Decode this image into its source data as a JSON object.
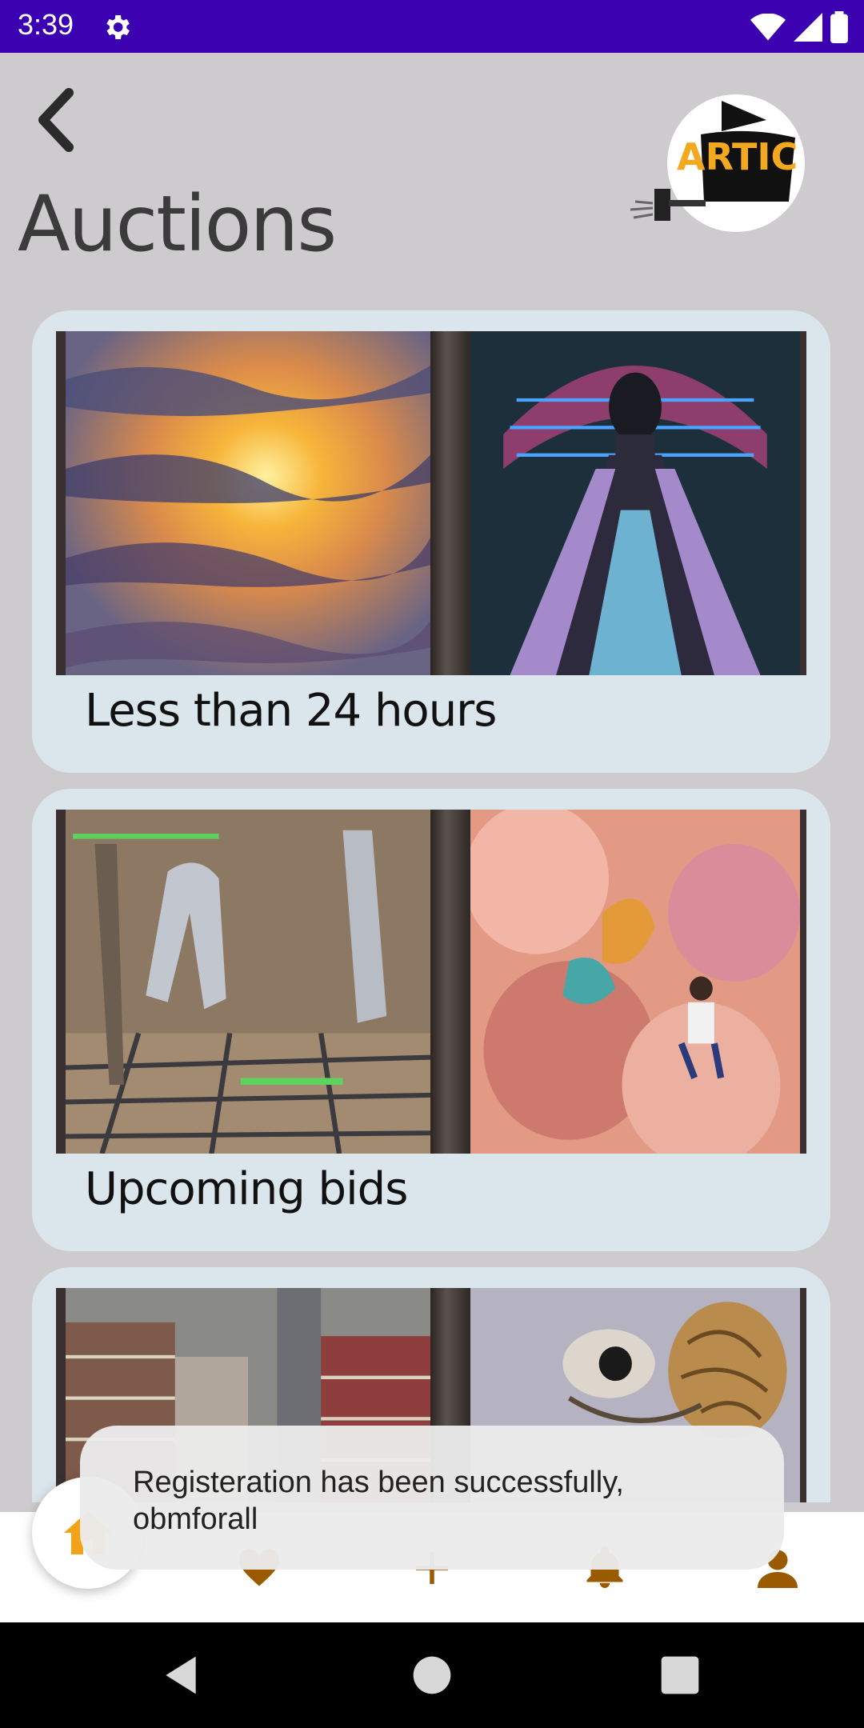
{
  "status_bar": {
    "time": "3:39",
    "settings_icon": "gear-icon",
    "wifi_icon": "wifi-icon",
    "signal_icon": "signal-icon",
    "battery_icon": "battery-icon"
  },
  "header": {
    "back_icon": "chevron-left-icon",
    "title": "Auctions",
    "logo_text": "ARTIC"
  },
  "cards": [
    {
      "label": "Less than 24 hours"
    },
    {
      "label": "Upcoming bids"
    },
    {
      "label": ""
    }
  ],
  "bottom_nav": {
    "items": [
      {
        "icon": "home-icon"
      },
      {
        "icon": "heart-icon"
      },
      {
        "icon": "plus-icon"
      },
      {
        "icon": "bell-icon"
      },
      {
        "icon": "person-icon"
      }
    ],
    "accent": "#f5a21b",
    "icon_color": "#9a5a00"
  },
  "toast": {
    "message": "Registeration has been successfully, obmforall"
  },
  "colors": {
    "status_bar": "#3b00b0",
    "background": "#cdcbcd",
    "card": "#dbe5ec"
  }
}
